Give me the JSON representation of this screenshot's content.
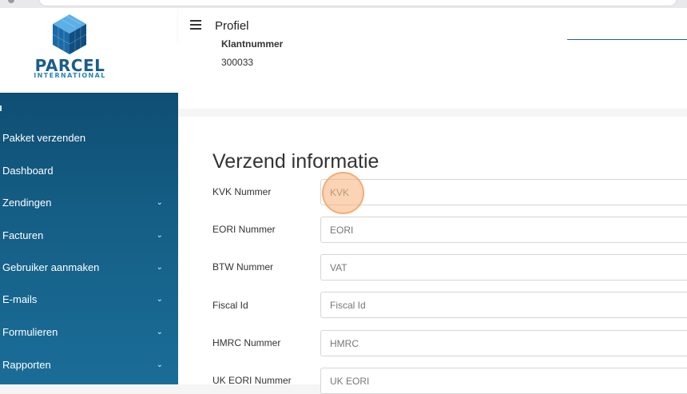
{
  "brand": {
    "name": "PARCEL",
    "subtitle": "INTERNATIONAL",
    "colors": {
      "primary": "#1a5e8c",
      "accent": "#2a83b4",
      "cube_light": "#3b97d3",
      "cube_dark": "#0f4e74"
    }
  },
  "topbar": {
    "menu_icon": "hamburger-icon",
    "title": "Profiel"
  },
  "sidebar": {
    "items": [
      {
        "label": "Pakket verzenden",
        "has_submenu": false
      },
      {
        "label": "Dashboard",
        "has_submenu": false
      },
      {
        "label": "Zendingen",
        "has_submenu": true
      },
      {
        "label": "Facturen",
        "has_submenu": true
      },
      {
        "label": "Gebruiker aanmaken",
        "has_submenu": true
      },
      {
        "label": "E-mails",
        "has_submenu": true
      },
      {
        "label": "Formulieren",
        "has_submenu": true
      },
      {
        "label": "Rapporten",
        "has_submenu": true
      }
    ],
    "chevron_glyph": "⌄"
  },
  "customer": {
    "label": "Klantnummer",
    "value": "300033"
  },
  "shipping_info": {
    "title": "Verzend informatie",
    "fields": [
      {
        "label": "KVK Nummer",
        "placeholder": "KVK"
      },
      {
        "label": "EORI Nummer",
        "placeholder": "EORI"
      },
      {
        "label": "BTW Nummer",
        "placeholder": "VAT"
      },
      {
        "label": "Fiscal Id",
        "placeholder": "Fiscal Id"
      },
      {
        "label": "HMRC Nummer",
        "placeholder": "HMRC"
      },
      {
        "label": "UK EORI Nummer",
        "placeholder": "UK EORI"
      }
    ]
  }
}
